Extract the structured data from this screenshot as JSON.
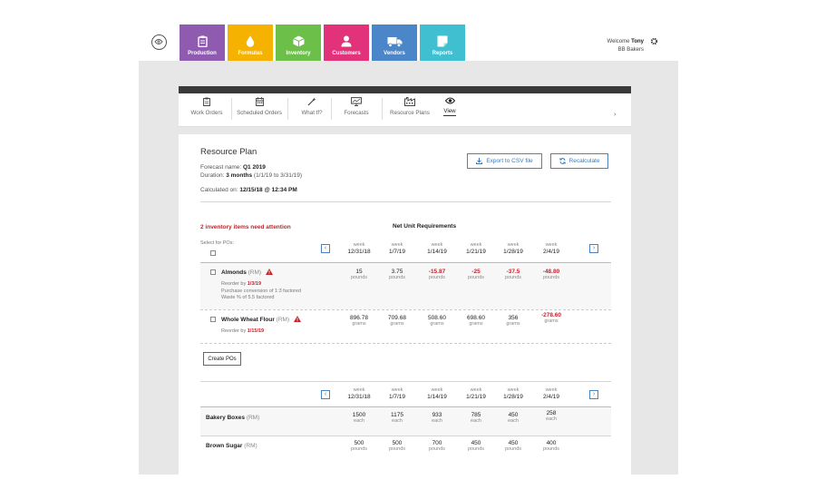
{
  "nav_tiles": [
    {
      "label": "Production",
      "color": "#8e5bb0",
      "icon": "clipboard-icon"
    },
    {
      "label": "Formulas",
      "color": "#f6b200",
      "icon": "drop-icon"
    },
    {
      "label": "Inventory",
      "color": "#6cc04a",
      "icon": "box-icon"
    },
    {
      "label": "Customers",
      "color": "#e2327a",
      "icon": "person-icon"
    },
    {
      "label": "Vendors",
      "color": "#4a86c8",
      "icon": "truck-icon"
    },
    {
      "label": "Reports",
      "color": "#3fbfd0",
      "icon": "report-icon"
    }
  ],
  "user": {
    "welcome_prefix": "Welcome",
    "name": "Tony",
    "company": "BB Bakers"
  },
  "subnav": [
    {
      "label": "Work Orders",
      "icon": "clipboard-icon"
    },
    {
      "label": "Scheduled Orders",
      "icon": "calendar-icon"
    },
    {
      "label": "What If?",
      "icon": "wand-icon"
    },
    {
      "label": "Forecasts",
      "icon": "forecast-icon"
    },
    {
      "label": "Resource Plans",
      "icon": "factory-icon"
    },
    {
      "label": "View",
      "icon": "eye-icon"
    }
  ],
  "plan": {
    "title": "Resource Plan",
    "forecast_label": "Forecast name:",
    "forecast_name": "Q1 2019",
    "duration_label": "Duration:",
    "duration_value": "3 months",
    "duration_range": "(1/1/19 to 3/31/19)",
    "calculated_label": "Calculated on:",
    "calculated_value": "12/15/18 @ 12:34 PM",
    "export_label": "Export to CSV file",
    "recalculate_label": "Recalculate"
  },
  "attention": {
    "message": "2 inventory items need attention",
    "net_header": "Net Unit Requirements",
    "select_label": "Select for POs:",
    "create_po_label": "Create POs"
  },
  "weeks": [
    {
      "label": "week",
      "date": "12/31/18"
    },
    {
      "label": "week",
      "date": "1/7/19"
    },
    {
      "label": "week",
      "date": "1/14/19"
    },
    {
      "label": "week",
      "date": "1/21/19"
    },
    {
      "label": "week",
      "date": "1/28/19"
    },
    {
      "label": "week",
      "date": "2/4/19"
    }
  ],
  "attention_items": [
    {
      "name": "Almonds",
      "rm": "(RM)",
      "reorder_label": "Reorder by",
      "reorder_date": "1/3/19",
      "notes": [
        "Purchase conversion of 1:3 factored",
        "Waste % of 5.5 factored"
      ],
      "values": [
        "15",
        "3.75",
        "-15.87",
        "-25",
        "-37.5",
        "-48.80"
      ],
      "unit": "pounds"
    },
    {
      "name": "Whole Wheat Flour",
      "rm": "(RM)",
      "reorder_label": "Reorder by",
      "reorder_date": "1/15/19",
      "notes": [],
      "values": [
        "896.78",
        "709.68",
        "508.60",
        "698.60",
        "356",
        "-278.60"
      ],
      "unit": "grams"
    }
  ],
  "other_items": [
    {
      "name": "Bakery Boxes",
      "rm": "(RM)",
      "values": [
        "1500",
        "1175",
        "933",
        "785",
        "450",
        "258"
      ],
      "unit": "each"
    },
    {
      "name": "Brown Sugar",
      "rm": "(RM)",
      "values": [
        "500",
        "500",
        "700",
        "450",
        "450",
        "400"
      ],
      "unit": "pounds"
    }
  ],
  "colors": {
    "accent": "#3d7ab8",
    "negative": "#c4242b",
    "warning": "#c4242b"
  }
}
